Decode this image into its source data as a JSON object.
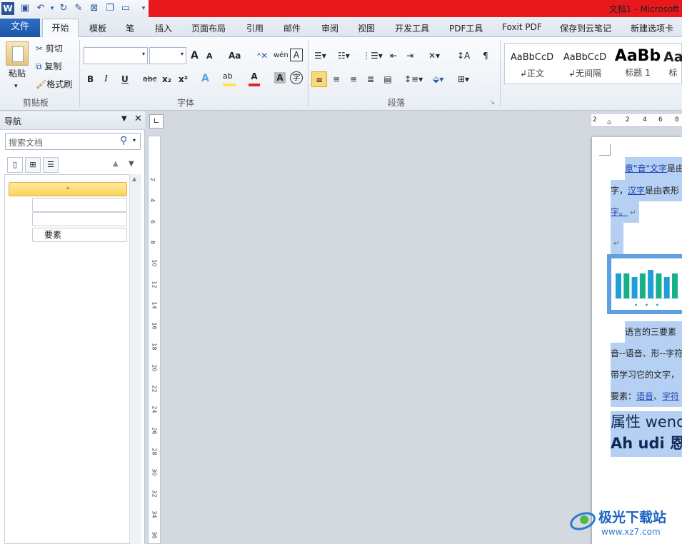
{
  "window": {
    "title": "文档1 - Microsoft"
  },
  "tabs": [
    {
      "label": "文件"
    },
    {
      "label": "开始"
    },
    {
      "label": "模板"
    },
    {
      "label": "笔"
    },
    {
      "label": "插入"
    },
    {
      "label": "页面布局"
    },
    {
      "label": "引用"
    },
    {
      "label": "邮件"
    },
    {
      "label": "审阅"
    },
    {
      "label": "视图"
    },
    {
      "label": "开发工具"
    },
    {
      "label": "PDF工具"
    },
    {
      "label": "Foxit PDF"
    },
    {
      "label": "保存到云笔记"
    },
    {
      "label": "新建选项卡"
    }
  ],
  "clipboard": {
    "paste": "粘贴",
    "cut": "剪切",
    "copy": "复制",
    "format_painter": "格式刷",
    "group": "剪贴板"
  },
  "font": {
    "group": "字体",
    "font_name": "",
    "font_size": "",
    "grow": "A",
    "shrink": "A",
    "case": "Aa",
    "bold": "B",
    "italic": "I",
    "underline": "U",
    "strike": "abc",
    "sub": "x₂",
    "sup": "x²"
  },
  "paragraph": {
    "group": "段落"
  },
  "styles": [
    {
      "preview": "AaBbCcD",
      "name": "正文"
    },
    {
      "preview": "AaBbCcD",
      "name": "无间隔"
    },
    {
      "preview": "AaBb",
      "name": "标题 1"
    },
    {
      "preview": "AaI",
      "name": "标"
    }
  ],
  "nav": {
    "title": "导航",
    "search_placeholder": "搜索文档",
    "headings": [
      "",
      "",
      "",
      "要素"
    ]
  },
  "ruler": {
    "horizontal": [
      "2",
      "2",
      "4",
      "6",
      "8"
    ],
    "vertical": [
      "2",
      "4",
      "6",
      "8",
      "10",
      "12",
      "14",
      "16",
      "18",
      "20",
      "22",
      "24",
      "26",
      "28",
      "30",
      "32",
      "34",
      "36"
    ]
  },
  "document": {
    "p1_link": "意\"音\"文字",
    "p1_rest": "是由",
    "p2_pre": "字，",
    "p2_link": "汉字",
    "p2_rest": "是由表形",
    "p3": "字。",
    "p4": "语言的三要素",
    "p5": "音--语音、形--字符",
    "p6": "带学习它的文字，",
    "p7_pre": "要素：",
    "p7_link1": "语音",
    "p7_sep": "、",
    "p7_link2": "字符",
    "heading1": "属性 wenc",
    "heading2": "Ah udi 恩大"
  },
  "chart_data": {
    "type": "bar",
    "values": [
      7,
      7,
      6,
      7,
      8,
      7,
      6,
      7
    ],
    "colors": [
      "#1f9fd8",
      "#18b087"
    ],
    "ylim": [
      0,
      10
    ]
  },
  "watermark": {
    "text": "极光下载站",
    "url": "www.xz7.com"
  }
}
